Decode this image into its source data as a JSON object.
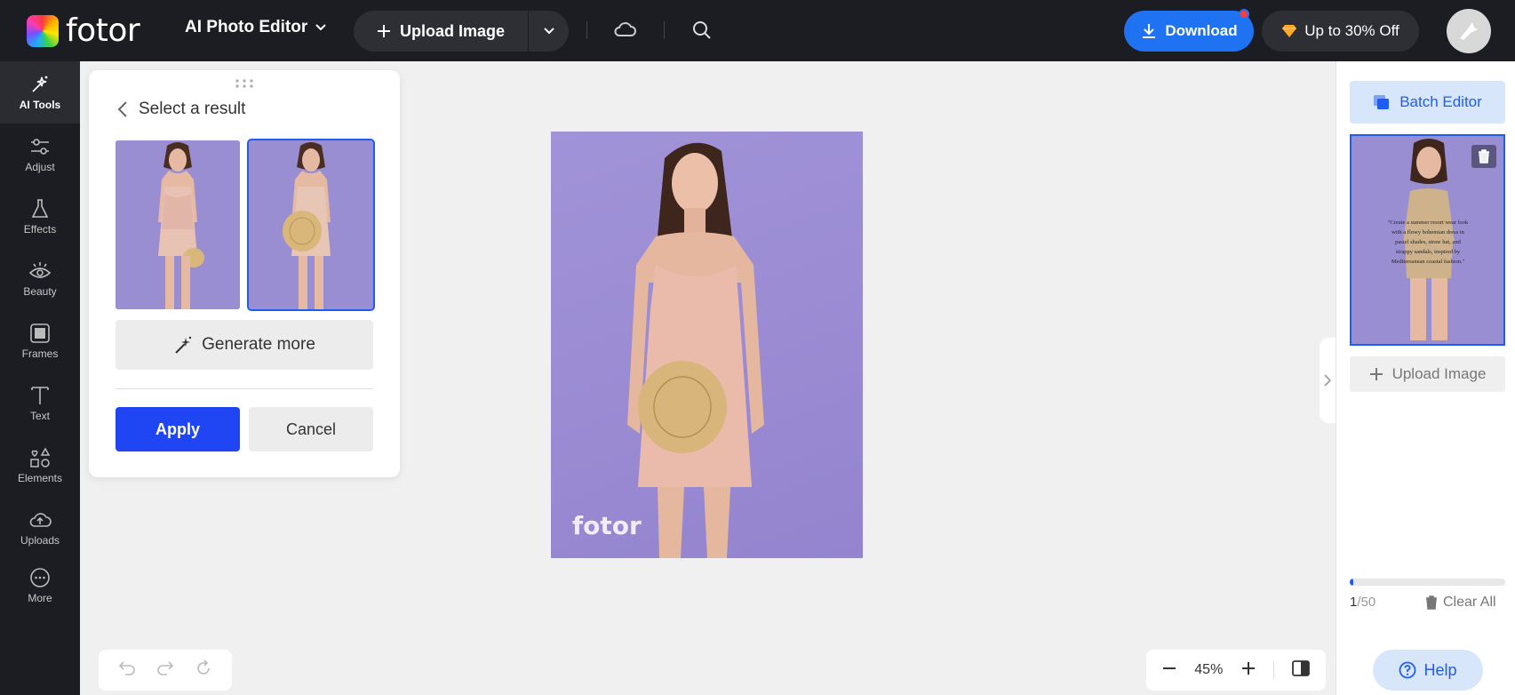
{
  "header": {
    "logo_text": "fotor",
    "menu_label": "AI Photo Editor",
    "upload_label": "Upload Image",
    "download_label": "Download",
    "promo_label": "Up to 30% Off"
  },
  "sidebar": {
    "items": [
      {
        "label": "AI Tools",
        "icon": "ai-tools-icon",
        "active": true
      },
      {
        "label": "Adjust",
        "icon": "adjust-icon"
      },
      {
        "label": "Effects",
        "icon": "effects-icon"
      },
      {
        "label": "Beauty",
        "icon": "beauty-icon"
      },
      {
        "label": "Frames",
        "icon": "frames-icon"
      },
      {
        "label": "Text",
        "icon": "text-icon"
      },
      {
        "label": "Elements",
        "icon": "elements-icon"
      },
      {
        "label": "Uploads",
        "icon": "uploads-icon"
      },
      {
        "label": "More",
        "icon": "more-icon"
      }
    ]
  },
  "panel": {
    "title": "Select a result",
    "results": [
      {
        "selected": false
      },
      {
        "selected": true
      }
    ],
    "generate_more_label": "Generate more",
    "apply_label": "Apply",
    "cancel_label": "Cancel"
  },
  "canvas": {
    "watermark": "fotor"
  },
  "right_panel": {
    "batch_editor_label": "Batch Editor",
    "thumb_caption": "\"Create a summer resort wear look with a flowy bohemian dress in pastel shades, straw hat, and strappy sandals, inspired by Mediterranean coastal fashion.\"",
    "upload_label": "Upload Image",
    "count_current": "1",
    "count_total": "/50",
    "progress_fraction": 0.02,
    "clear_all_label": "Clear All",
    "help_label": "Help"
  },
  "zoom": {
    "level": "45%"
  },
  "colors": {
    "accent": "#1f5cf2",
    "apply": "#1f46f2",
    "download": "#1f73f2",
    "dark": "#1b1d22",
    "photo_bg": "#9a8ed3"
  }
}
